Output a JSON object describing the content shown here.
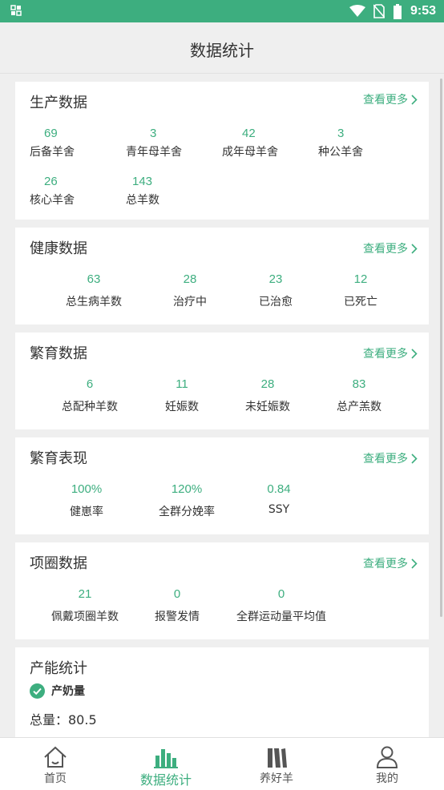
{
  "status_bar": {
    "time": "9:53",
    "icons": [
      "app-grid-icon",
      "wifi-icon",
      "no-sim-icon",
      "battery-icon"
    ]
  },
  "header": {
    "title": "数据统计"
  },
  "sections": {
    "production": {
      "title": "生产数据",
      "more": "查看更多",
      "stats": [
        {
          "value": "69",
          "label": "后备羊舍"
        },
        {
          "value": "3",
          "label": "青年母羊舍"
        },
        {
          "value": "42",
          "label": "成年母羊舍"
        },
        {
          "value": "3",
          "label": "种公羊舍"
        },
        {
          "value": "26",
          "label": "核心羊舍"
        },
        {
          "value": "143",
          "label": "总羊数"
        }
      ]
    },
    "health": {
      "title": "健康数据",
      "more": "查看更多",
      "stats": [
        {
          "value": "63",
          "label": "总生病羊数"
        },
        {
          "value": "28",
          "label": "治疗中"
        },
        {
          "value": "23",
          "label": "已治愈"
        },
        {
          "value": "12",
          "label": "已死亡"
        }
      ]
    },
    "breeding": {
      "title": "繁育数据",
      "more": "查看更多",
      "stats": [
        {
          "value": "6",
          "label": "总配种羊数"
        },
        {
          "value": "11",
          "label": "妊娠数"
        },
        {
          "value": "28",
          "label": "未妊娠数"
        },
        {
          "value": "83",
          "label": "总产羔数"
        }
      ]
    },
    "performance": {
      "title": "繁育表现",
      "more": "查看更多",
      "stats": [
        {
          "value": "100%",
          "label": "健崽率"
        },
        {
          "value": "120%",
          "label": "全群分娩率"
        },
        {
          "value": "0.84",
          "label": "SSY"
        }
      ]
    },
    "collar": {
      "title": "项圈数据",
      "more": "查看更多",
      "stats": [
        {
          "value": "21",
          "label": "佩戴项圈羊数"
        },
        {
          "value": "0",
          "label": "报警发情"
        },
        {
          "value": "0",
          "label": "全群运动量平均值"
        }
      ]
    },
    "capacity": {
      "title": "产能统计",
      "checkbox_label": "产奶量",
      "total": "总量：80.5"
    }
  },
  "bottom_nav": [
    {
      "label": "首页",
      "icon": "home-icon",
      "active": false
    },
    {
      "label": "数据统计",
      "icon": "bar-chart-icon",
      "active": true
    },
    {
      "label": "养好羊",
      "icon": "books-icon",
      "active": false
    },
    {
      "label": "我的",
      "icon": "person-icon",
      "active": false
    }
  ],
  "colors": {
    "accent": "#3dae7f",
    "status_bar": "#3dae7f",
    "background": "#efefef",
    "card": "#ffffff",
    "text": "#333333"
  }
}
